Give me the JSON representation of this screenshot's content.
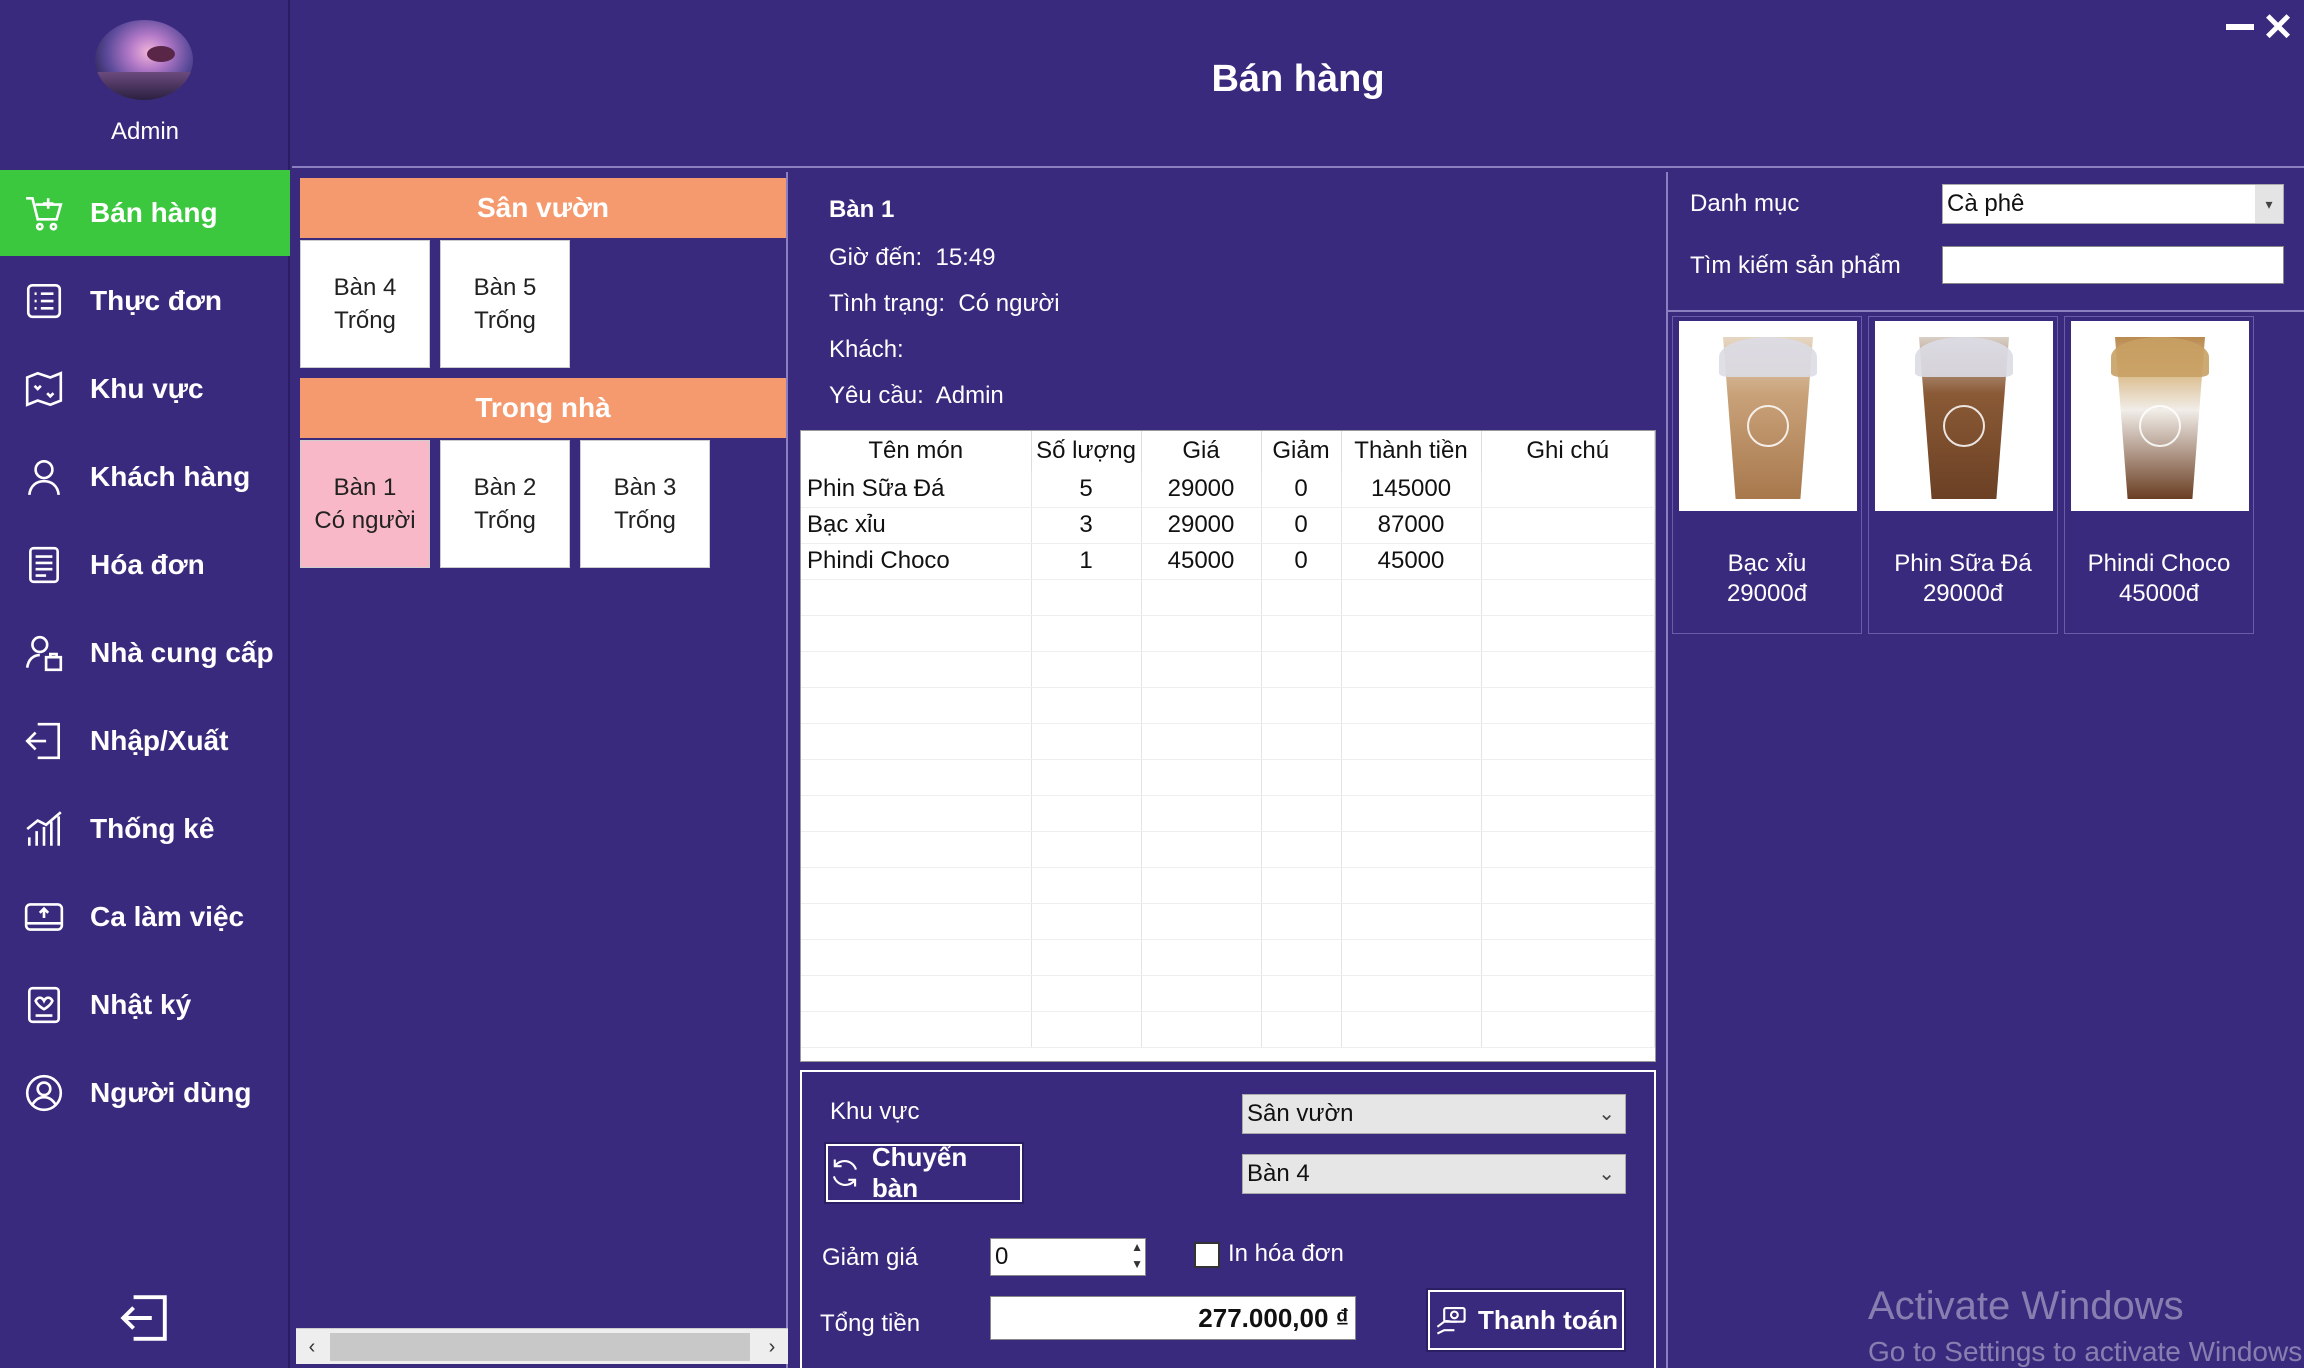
{
  "user": {
    "name": "Admin"
  },
  "page_title": "Bán hàng",
  "sidebar": {
    "items": [
      {
        "label": "Bán hàng",
        "icon": "cart-add-icon"
      },
      {
        "label": "Thực đơn",
        "icon": "menu-list-icon"
      },
      {
        "label": "Khu vực",
        "icon": "map-icon"
      },
      {
        "label": "Khách hàng",
        "icon": "person-icon"
      },
      {
        "label": "Hóa đơn",
        "icon": "receipt-icon"
      },
      {
        "label": "Nhà cung cấp",
        "icon": "supplier-icon"
      },
      {
        "label": "Nhập/Xuất",
        "icon": "import-export-icon"
      },
      {
        "label": "Thống kê",
        "icon": "chart-icon"
      },
      {
        "label": "Ca làm việc",
        "icon": "shift-icon"
      },
      {
        "label": "Nhật ký",
        "icon": "journal-icon"
      },
      {
        "label": "Người dùng",
        "icon": "user-circle-icon"
      }
    ]
  },
  "areas": [
    {
      "name": "Sân vườn",
      "tables": [
        {
          "name": "Bàn 4",
          "status": "Trống",
          "busy": false
        },
        {
          "name": "Bàn 5",
          "status": "Trống",
          "busy": false
        }
      ]
    },
    {
      "name": "Trong nhà",
      "tables": [
        {
          "name": "Bàn 1",
          "status": "Có người",
          "busy": true
        },
        {
          "name": "Bàn 2",
          "status": "Trống",
          "busy": false
        },
        {
          "name": "Bàn 3",
          "status": "Trống",
          "busy": false
        }
      ]
    }
  ],
  "order": {
    "table_name": "Bàn 1",
    "arrival_label": "Giờ đến:",
    "arrival_time": "15:49",
    "status_label": "Tình trạng:",
    "status_value": "Có người",
    "customer_label": "Khách:",
    "customer_value": "",
    "request_label": "Yêu cầu:",
    "request_value": "Admin"
  },
  "grid": {
    "columns": [
      "Tên món",
      "Số lượng",
      "Giá",
      "Giảm",
      "Thành tiền",
      "Ghi chú"
    ],
    "rows": [
      [
        "Phin Sữa Đá",
        "5",
        "29000",
        "0",
        "145000",
        ""
      ],
      [
        "Bạc xỉu",
        "3",
        "29000",
        "0",
        "87000",
        ""
      ],
      [
        "Phindi Choco",
        "1",
        "45000",
        "0",
        "45000",
        ""
      ]
    ]
  },
  "transfer": {
    "area_label": "Khu vực",
    "area_value": "Sân vườn",
    "table_value": "Bàn 4",
    "button_label": "Chuyển bàn"
  },
  "payment": {
    "discount_label": "Giảm giá",
    "discount_value": "0",
    "print_label": "In hóa đơn",
    "print_checked": false,
    "total_label": "Tổng tiền",
    "total_value": "277.000,00 ₫",
    "pay_button_label": "Thanh toán"
  },
  "products_filter": {
    "category_label": "Danh mục",
    "category_value": "Cà phê",
    "search_label": "Tìm kiếm sản phẩm",
    "search_value": ""
  },
  "products": [
    {
      "name": "Bạc xỉu",
      "price": "29000đ",
      "color": "#b98a5a"
    },
    {
      "name": "Phin Sữa Đá",
      "price": "29000đ",
      "color": "#7a4a2a"
    },
    {
      "name": "Phindi Choco",
      "price": "45000đ",
      "color": "#5e3a22"
    }
  ],
  "watermark": {
    "line1": "Activate Windows",
    "line2": "Go to Settings to activate Windows."
  }
}
